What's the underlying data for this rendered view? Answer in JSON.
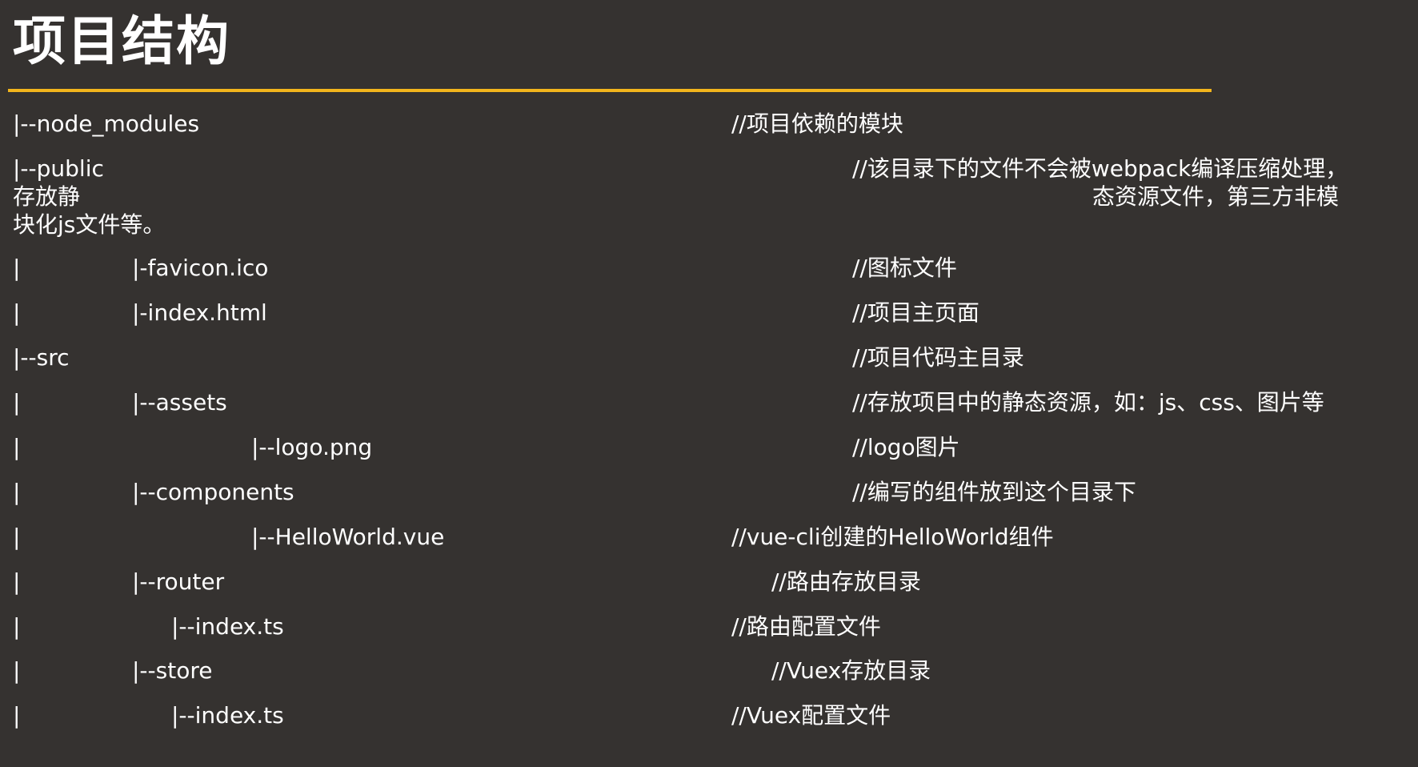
{
  "title": "项目结构",
  "colors": {
    "background": "#353230",
    "accent": "#f2b51c",
    "text": "#ffffff"
  },
  "rows": [
    {
      "tree": "|--node_modules",
      "comment": "//项目依赖的模块"
    },
    {
      "tree": "|--public",
      "comment": "//该目录下的文件不会被webpack编译压缩处理，",
      "tree_cont": "存放静",
      "comment_cont": "态资源文件，第三方非模",
      "tree_cont2": "块化js文件等。"
    },
    {
      "bar": "|",
      "tree": "|-favicon.ico",
      "comment": "//图标文件"
    },
    {
      "bar": "|",
      "tree": "|-index.html",
      "comment": "//项目主页面"
    },
    {
      "tree": "|--src",
      "comment": "//项目代码主目录"
    },
    {
      "bar": "|",
      "tree": "|--assets",
      "comment": "//存放项目中的静态资源，如：js、css、图片等"
    },
    {
      "bar": "|",
      "tree": "|--logo.png",
      "comment": "//logo图片"
    },
    {
      "bar": "|",
      "tree": "|--components",
      "comment": "//编写的组件放到这个目录下"
    },
    {
      "bar": "|",
      "tree": "|--HelloWorld.vue",
      "comment": "//vue-cli创建的HelloWorld组件"
    },
    {
      "bar": "|",
      "tree": "|--router",
      "comment": "//路由存放目录"
    },
    {
      "bar": "|",
      "tree": "|--index.ts",
      "comment": "//路由配置文件"
    },
    {
      "bar": "|",
      "tree": "|--store",
      "comment": "//Vuex存放目录"
    },
    {
      "bar": "|",
      "tree": "|--index.ts",
      "comment": "//Vuex配置文件"
    }
  ]
}
